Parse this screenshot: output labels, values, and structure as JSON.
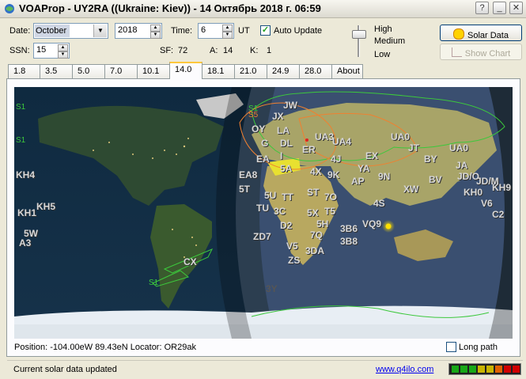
{
  "window": {
    "title": "VOAProp - UY2RA ((Ukraine: Kiev)) - 14 Октябрь 2018 г. 06:59"
  },
  "controls": {
    "date_label": "Date:",
    "month": "October",
    "year": "2018",
    "time_label": "Time:",
    "time": "6",
    "time_unit": "UT",
    "auto_update_label": "Auto Update",
    "auto_update_checked": true,
    "ssn_label": "SSN:",
    "ssn": "15",
    "sf_label": "SF:",
    "sf": "72",
    "a_label": "A:",
    "a": "14",
    "k_label": "K:",
    "k": "1"
  },
  "reliability": {
    "high": "High",
    "medium": "Medium",
    "low": "Low"
  },
  "buttons": {
    "solar_data": "Solar Data",
    "show_chart": "Show Chart"
  },
  "tabs": [
    "1.8",
    "3.5",
    "5.0",
    "7.0",
    "10.1",
    "14.0",
    "18.1",
    "21.0",
    "24.9",
    "28.0",
    "About"
  ],
  "active_tab": "14.0",
  "map": {
    "labels": {
      "s1": "S1",
      "jw": "JW",
      "jx": "JX",
      "s5": "S5",
      "oy": "OY",
      "la": "LA",
      "g": "G",
      "dl": "DL",
      "ua3": "UA3",
      "ua4": "UA4",
      "er": "ER",
      "i": "I",
      "ea": "EA",
      "sa5": "5A",
      "ex": "EX",
      "ua0a": "UA0",
      "jt": "JT",
      "ua0b": "UA0",
      "j4": "4J",
      "ya": "YA",
      "by": "BY",
      "ja": "JA",
      "ea8": "EA8",
      "x4": "4X",
      "k9": "9K",
      "n9": "9N",
      "jdo": "JD/O",
      "jdm": "JD/M",
      "ap": "AP",
      "bv": "BV",
      "kh4": "KH4",
      "t5": "5T",
      "u5": "5U",
      "tt": "TT",
      "st": "ST",
      "o7": "7O",
      "xw": "XW",
      "kh0": "KH0",
      "kh9": "KH9",
      "kh5": "KH5",
      "tu": "TU",
      "c3": "3C",
      "x5": "5X",
      "t5b": "T5",
      "s4": "4S",
      "v6": "V6",
      "kh1": "KH1",
      "d2": "D2",
      "h5": "5H",
      "b6": "3B6",
      "vq9": "VQ9",
      "c2": "C2",
      "w5": "5W",
      "zd7": "ZD7",
      "q7": "7Q",
      "b8": "3B8",
      "a3": "A3",
      "v5": "V5",
      "da3": "3DA",
      "zs": "ZS",
      "cx": "CX",
      "s1b": "S1",
      "y3": "3Y",
      "s1c": "S1",
      "s1d": "S1"
    },
    "footer": {
      "position_label": "Position:",
      "position": "-104.00eW 89.43eN",
      "locator_label": "Locator:",
      "locator": "OR29ak",
      "long_path_label": "Long path",
      "long_path_checked": false
    }
  },
  "status": {
    "text": "Current solar data updated",
    "link": "www.q4ilo.com",
    "signal_colors": [
      "#18a818",
      "#18a818",
      "#18a818",
      "#c8b400",
      "#c8b400",
      "#e06000",
      "#d00000",
      "#d00000"
    ]
  }
}
